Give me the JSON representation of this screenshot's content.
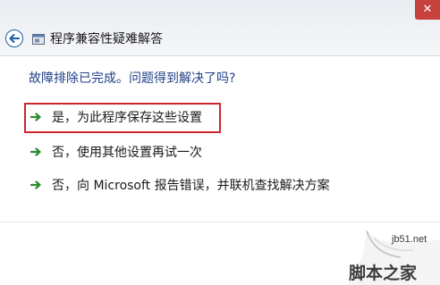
{
  "window": {
    "title": "程序兼容性疑难解答",
    "close_glyph": "✕",
    "back_icon": "back-arrow-icon",
    "app_icon": "troubleshooter-app-icon"
  },
  "main": {
    "heading": "故障排除已完成。问题得到解决了吗?",
    "options": [
      {
        "label": "是，为此程序保存这些设置",
        "icon": "green-arrow-icon",
        "highlighted": true
      },
      {
        "label": "否，使用其他设置再试一次",
        "icon": "green-arrow-icon",
        "highlighted": false
      },
      {
        "label": "否，向 Microsoft 报告错误，并联机查找解决方案",
        "icon": "green-arrow-icon",
        "highlighted": false
      }
    ]
  },
  "watermark": {
    "url": "jb51.net",
    "name": "脚本之家"
  },
  "colors": {
    "heading": "#1f3f87",
    "arrow": "#2f8a2f",
    "highlight_border": "#c9272b",
    "close_button": "#c7423c",
    "back_button": "#1f5ea8"
  }
}
